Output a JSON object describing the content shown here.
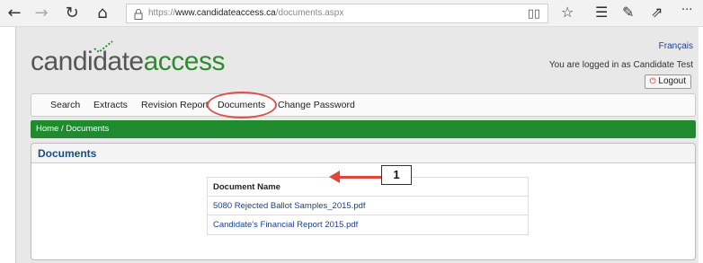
{
  "browser": {
    "back_icon": "←",
    "forward_icon": "→",
    "refresh_icon": "↻",
    "home_icon": "⌂",
    "url_prefix": "https://",
    "url_domain": "www.candidateaccess.ca",
    "url_path": "/documents.aspx",
    "reading_icon": "▯▯",
    "favorite_icon": "☆",
    "favorites_bar_icon": "☰",
    "pen_icon": "✎",
    "share_icon": "⇗",
    "more_icon": "···"
  },
  "site": {
    "logo_part1": "candidate",
    "logo_part2": "access",
    "language_link": "Français",
    "logged_in_text": "You are logged in as Candidate Test",
    "logout_icon": "⏻",
    "logout_label": "Logout"
  },
  "menu": {
    "items": [
      "Search",
      "Extracts",
      "Revision Report",
      "Documents",
      "Change Password"
    ]
  },
  "breadcrumb": "Home / Documents",
  "panel": {
    "title": "Documents"
  },
  "documents": {
    "column_header": "Document Name",
    "rows": [
      "5080 Rejected Ballot Samples_2015.pdf",
      "Candidate's Financial Report 2015.pdf"
    ]
  },
  "annotation": {
    "callout_number": "1",
    "accent_color": "#e0443a"
  },
  "colors": {
    "brand_green": "#1f8a2e",
    "link_blue": "#1b3f8a"
  }
}
